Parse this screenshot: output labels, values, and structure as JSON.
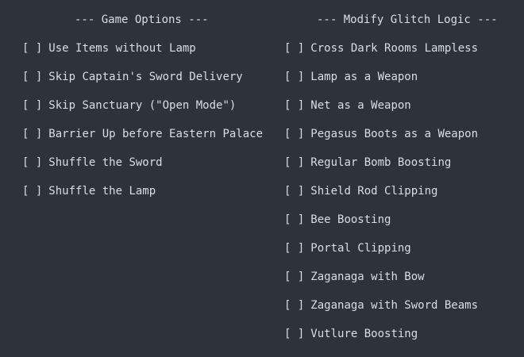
{
  "game_options": {
    "title": "--- Game Options ---",
    "items": [
      {
        "checkbox": "[ ]",
        "label": "Use Items without Lamp"
      },
      {
        "checkbox": "[ ]",
        "label": "Skip Captain's Sword Delivery"
      },
      {
        "checkbox": "[ ]",
        "label": "Skip Sanctuary (\"Open Mode\")"
      },
      {
        "checkbox": "[ ]",
        "label": "Barrier Up before Eastern Palace"
      },
      {
        "checkbox": "[ ]",
        "label": "Shuffle the Sword"
      },
      {
        "checkbox": "[ ]",
        "label": "Shuffle the Lamp"
      }
    ]
  },
  "glitch_logic": {
    "title": "--- Modify Glitch Logic ---",
    "items": [
      {
        "checkbox": "[ ]",
        "label": "Cross Dark Rooms Lampless"
      },
      {
        "checkbox": "[ ]",
        "label": "Lamp as a Weapon"
      },
      {
        "checkbox": "[ ]",
        "label": "Net as a Weapon"
      },
      {
        "checkbox": "[ ]",
        "label": "Pegasus Boots as a Weapon"
      },
      {
        "checkbox": "[ ]",
        "label": "Regular Bomb Boosting"
      },
      {
        "checkbox": "[ ]",
        "label": "Shield Rod Clipping"
      },
      {
        "checkbox": "[ ]",
        "label": "Bee Boosting"
      },
      {
        "checkbox": "[ ]",
        "label": "Portal Clipping"
      },
      {
        "checkbox": "[ ]",
        "label": "Zaganaga with Bow"
      },
      {
        "checkbox": "[ ]",
        "label": "Zaganaga with Sword Beams"
      },
      {
        "checkbox": "[ ]",
        "label": "Vutlure Boosting"
      }
    ]
  },
  "colors": {
    "background": "#2d333b",
    "text": "#d8dee6"
  }
}
